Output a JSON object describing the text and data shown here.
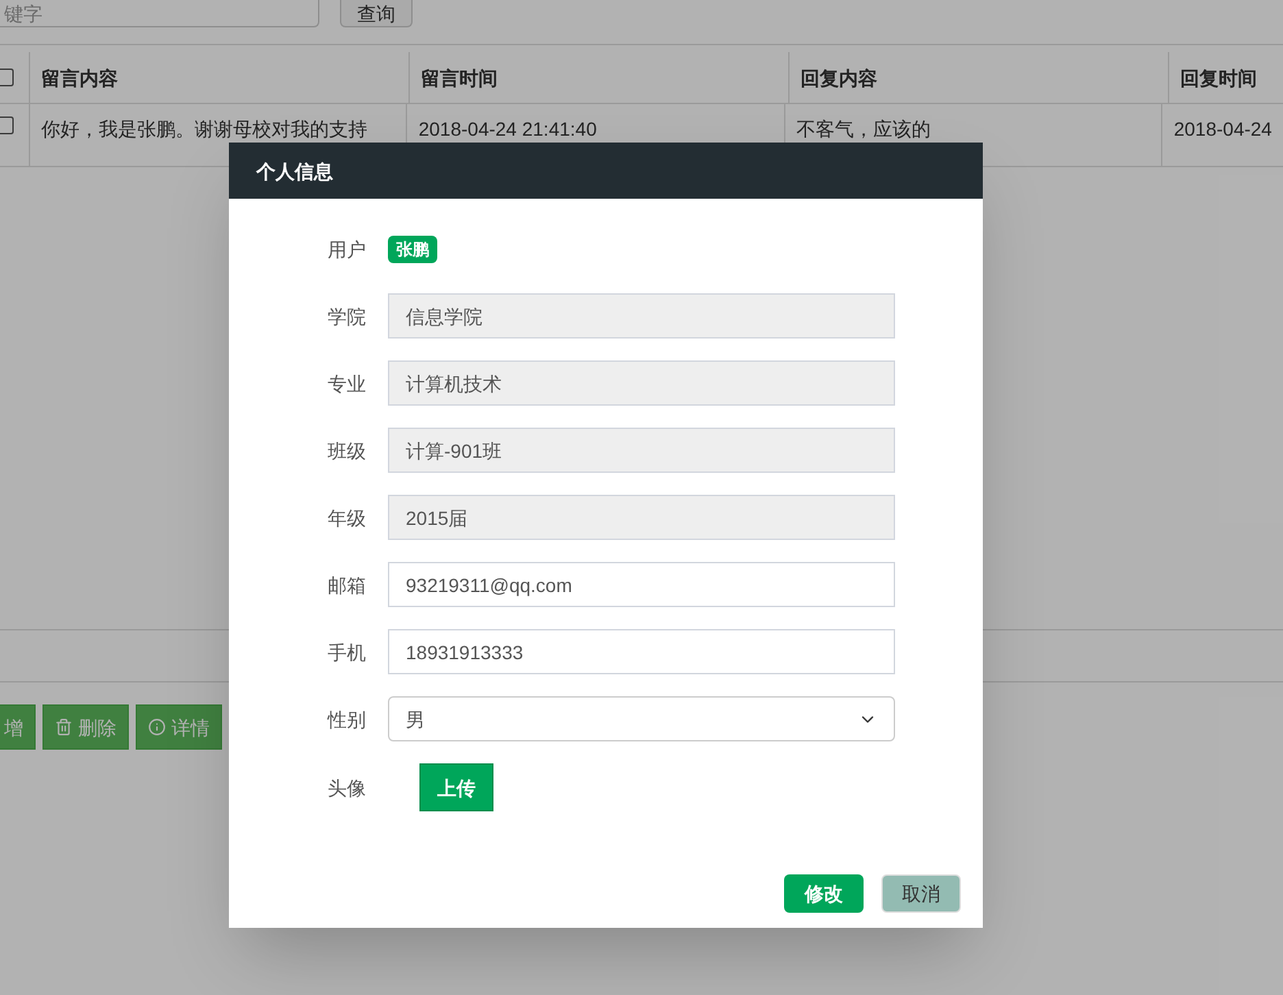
{
  "search": {
    "placeholder": "键字",
    "button": "查询"
  },
  "table": {
    "columns": [
      {
        "label": "留言内容"
      },
      {
        "label": "留言时间"
      },
      {
        "label": "回复内容"
      },
      {
        "label": "回复时间"
      }
    ],
    "rows": [
      {
        "checked": false,
        "cells": [
          "你好，我是张鹏。谢谢母校对我的支持",
          "2018-04-24 21:41:40",
          "不客气，应该的",
          "2018-04-24"
        ]
      }
    ],
    "header_checked": false
  },
  "actions": [
    {
      "label": "增",
      "kind": "add"
    },
    {
      "label": "删除",
      "kind": "delete"
    },
    {
      "label": "详情",
      "kind": "info"
    }
  ],
  "dialog": {
    "title": "个人信息",
    "fields": [
      {
        "label": "用户",
        "kind": "badge",
        "value": "张鹏"
      },
      {
        "label": "学院",
        "kind": "readonly",
        "value": "信息学院"
      },
      {
        "label": "专业",
        "kind": "readonly",
        "value": "计算机技术"
      },
      {
        "label": "班级",
        "kind": "readonly",
        "value": "计算-901班"
      },
      {
        "label": "年级",
        "kind": "readonly",
        "value": "2015届"
      },
      {
        "label": "邮箱",
        "kind": "input",
        "value": "93219311@qq.com"
      },
      {
        "label": "手机",
        "kind": "input",
        "value": "18931913333"
      },
      {
        "label": "性别",
        "kind": "select",
        "value": "男"
      },
      {
        "label": "头像",
        "kind": "upload",
        "value": "上传"
      }
    ],
    "buttons": [
      {
        "label": "修改",
        "kind": "primary"
      },
      {
        "label": "取消",
        "kind": "secondary"
      }
    ]
  }
}
